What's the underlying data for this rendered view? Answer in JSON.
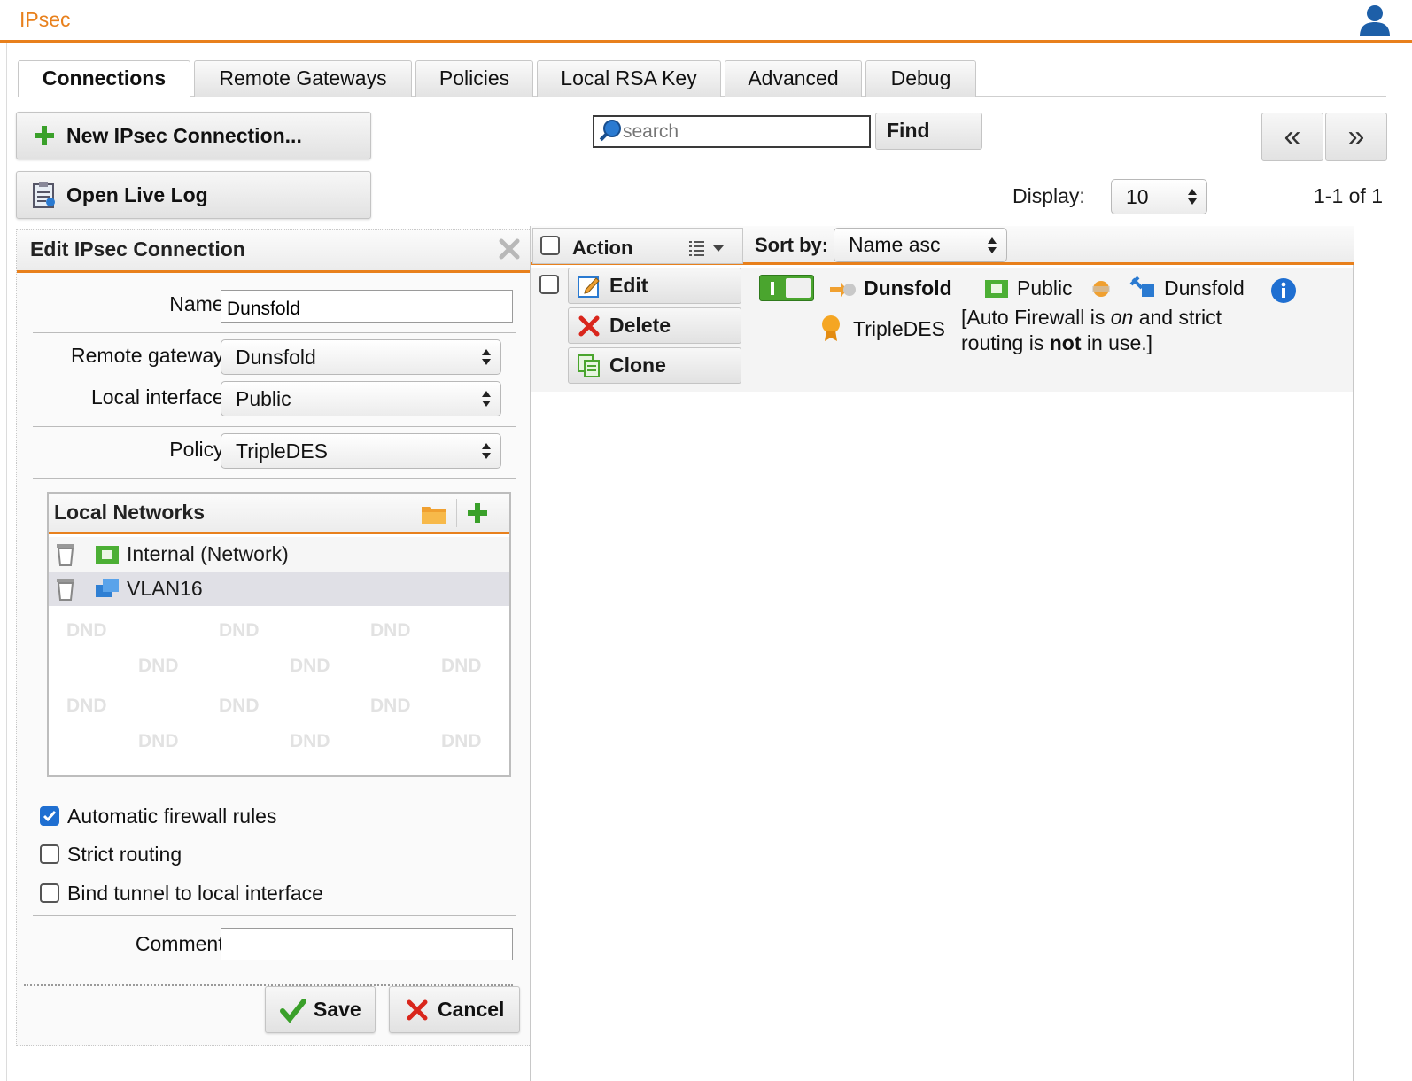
{
  "app": {
    "title": "IPsec"
  },
  "tabs": [
    {
      "label": "Connections",
      "active": true
    },
    {
      "label": "Remote Gateways",
      "active": false
    },
    {
      "label": "Policies",
      "active": false
    },
    {
      "label": "Local RSA Key",
      "active": false
    },
    {
      "label": "Advanced",
      "active": false
    },
    {
      "label": "Debug",
      "active": false
    }
  ],
  "toolbar": {
    "new_connection_label": "New IPsec Connection...",
    "open_live_log_label": "Open Live Log",
    "search_placeholder": "search",
    "find_label": "Find",
    "prev_label": "«",
    "next_label": "»",
    "display_label": "Display:",
    "display_value": "10",
    "range_text": "1-1 of 1"
  },
  "edit_panel": {
    "title": "Edit IPsec Connection",
    "name_label": "Name:",
    "name_value": "Dunsfold",
    "remote_gateway_label": "Remote gateway:",
    "remote_gateway_value": "Dunsfold",
    "local_interface_label": "Local interface:",
    "local_interface_value": "Public",
    "policy_label": "Policy:",
    "policy_value": "TripleDES",
    "local_networks": {
      "title": "Local Networks",
      "items": [
        {
          "label": "Internal (Network)",
          "icon": "network-icon"
        },
        {
          "label": "VLAN16",
          "icon": "vlan-icon"
        }
      ],
      "dnd_text": "DND"
    },
    "checkboxes": [
      {
        "label": "Automatic firewall rules",
        "checked": true
      },
      {
        "label": "Strict routing",
        "checked": false
      },
      {
        "label": "Bind tunnel to local interface",
        "checked": false
      }
    ],
    "comment_label": "Comment:",
    "comment_value": "",
    "save_label": "Save",
    "cancel_label": "Cancel"
  },
  "list": {
    "action_header": "Action",
    "sort_label": "Sort by:",
    "sort_value": "Name asc",
    "row": {
      "actions": [
        "Edit",
        "Delete",
        "Clone"
      ],
      "enabled": true,
      "name": "Dunsfold",
      "interface": "Public",
      "gateway": "Dunsfold",
      "policy": "TripleDES",
      "note_part1": "[Auto Firewall is ",
      "note_on": "on",
      "note_part2": " and strict",
      "note_part3": "routing is ",
      "note_not": "not",
      "note_part4": " in use.]"
    }
  },
  "colors": {
    "accent": "#e8801c",
    "checkbox": "#1f6fd1",
    "green": "#4aa52e",
    "info": "#1f6fd1"
  }
}
